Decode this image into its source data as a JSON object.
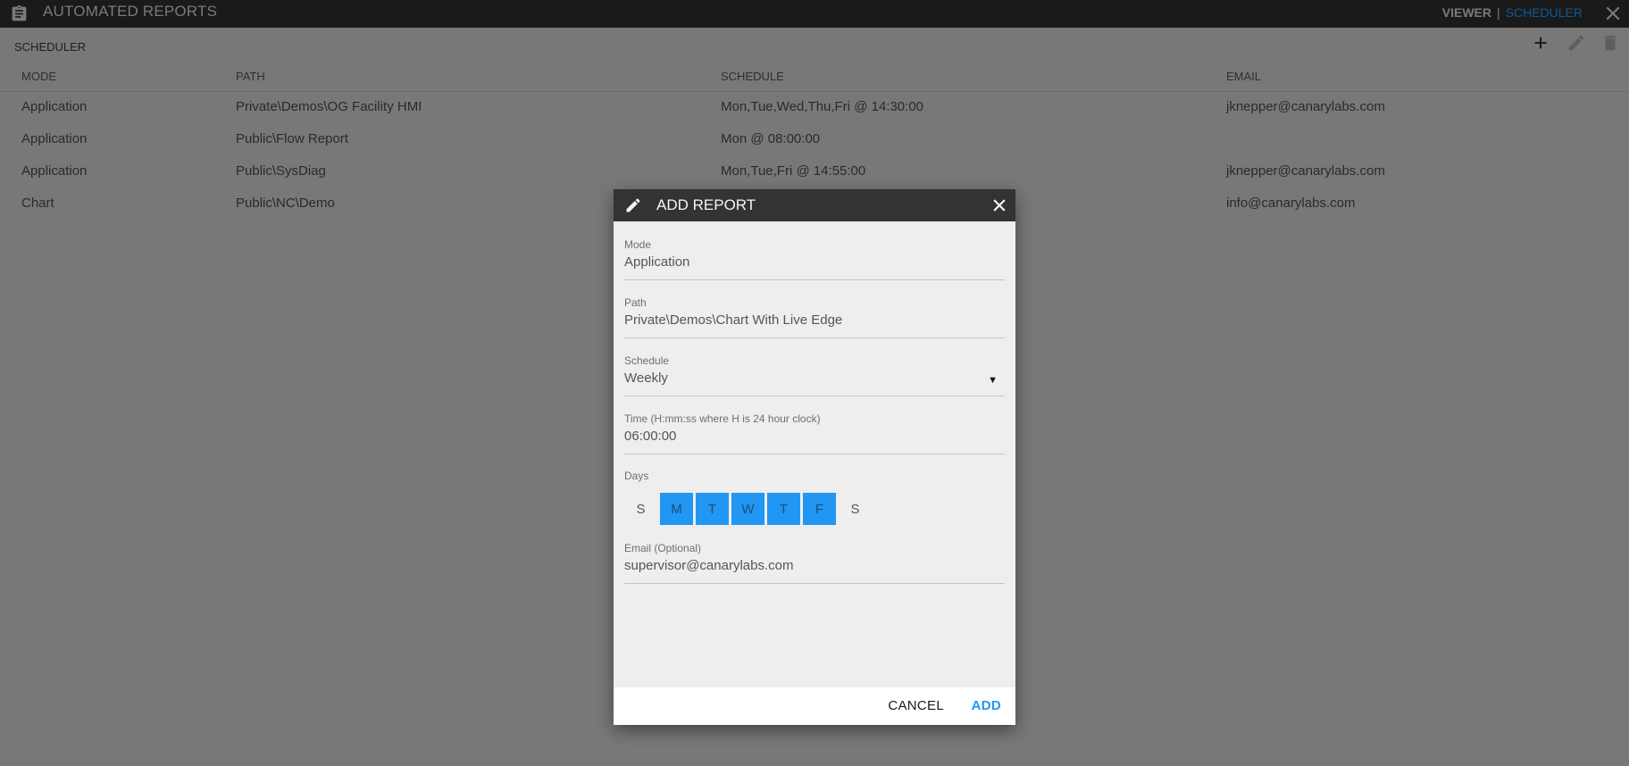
{
  "app": {
    "title": "AUTOMATED REPORTS",
    "icon": "clipboard-icon",
    "nav": {
      "viewer": "VIEWER",
      "separator": "|",
      "scheduler": "SCHEDULER"
    },
    "close_icon": "close-icon"
  },
  "colors": {
    "accent": "#2196f3",
    "topbar": "#1a1a1a",
    "overlay": "#787878",
    "dialog_header": "#333333",
    "dialog_body": "#eeeeee"
  },
  "scheduler": {
    "title": "SCHEDULER",
    "toolbar": {
      "add": "plus-icon",
      "edit": "pencil-icon",
      "delete": "trash-icon"
    },
    "columns": [
      "MODE",
      "PATH",
      "SCHEDULE",
      "EMAIL"
    ],
    "rows": [
      {
        "mode": "Application",
        "path": "Private\\Demos\\OG Facility HMI",
        "schedule": "Mon,Tue,Wed,Thu,Fri @ 14:30:00",
        "email": "jknepper@canarylabs.com"
      },
      {
        "mode": "Application",
        "path": "Public\\Flow Report",
        "schedule": "Mon @ 08:00:00",
        "email": ""
      },
      {
        "mode": "Application",
        "path": "Public\\SysDiag",
        "schedule": "Mon,Tue,Fri @ 14:55:00",
        "email": "jknepper@canarylabs.com"
      },
      {
        "mode": "Chart",
        "path": "Public\\NC\\Demo",
        "schedule": "",
        "email": "info@canarylabs.com"
      }
    ]
  },
  "dialog": {
    "title": "ADD REPORT",
    "fields": {
      "mode": {
        "label": "Mode",
        "value": "Application"
      },
      "path": {
        "label": "Path",
        "value": "Private\\Demos\\Chart With Live Edge"
      },
      "schedule": {
        "label": "Schedule",
        "value": "Weekly"
      },
      "time": {
        "label": "Time (H:mm:ss where H is 24 hour clock)",
        "value": "06:00:00"
      },
      "email": {
        "label": "Email (Optional)",
        "value": "supervisor@canarylabs.com"
      }
    },
    "days_label": "Days",
    "days": [
      {
        "label": "S",
        "selected": false
      },
      {
        "label": "M",
        "selected": true
      },
      {
        "label": "T",
        "selected": true
      },
      {
        "label": "W",
        "selected": true
      },
      {
        "label": "T",
        "selected": true
      },
      {
        "label": "F",
        "selected": true
      },
      {
        "label": "S",
        "selected": false
      }
    ],
    "buttons": {
      "cancel": "CANCEL",
      "add": "ADD"
    }
  }
}
